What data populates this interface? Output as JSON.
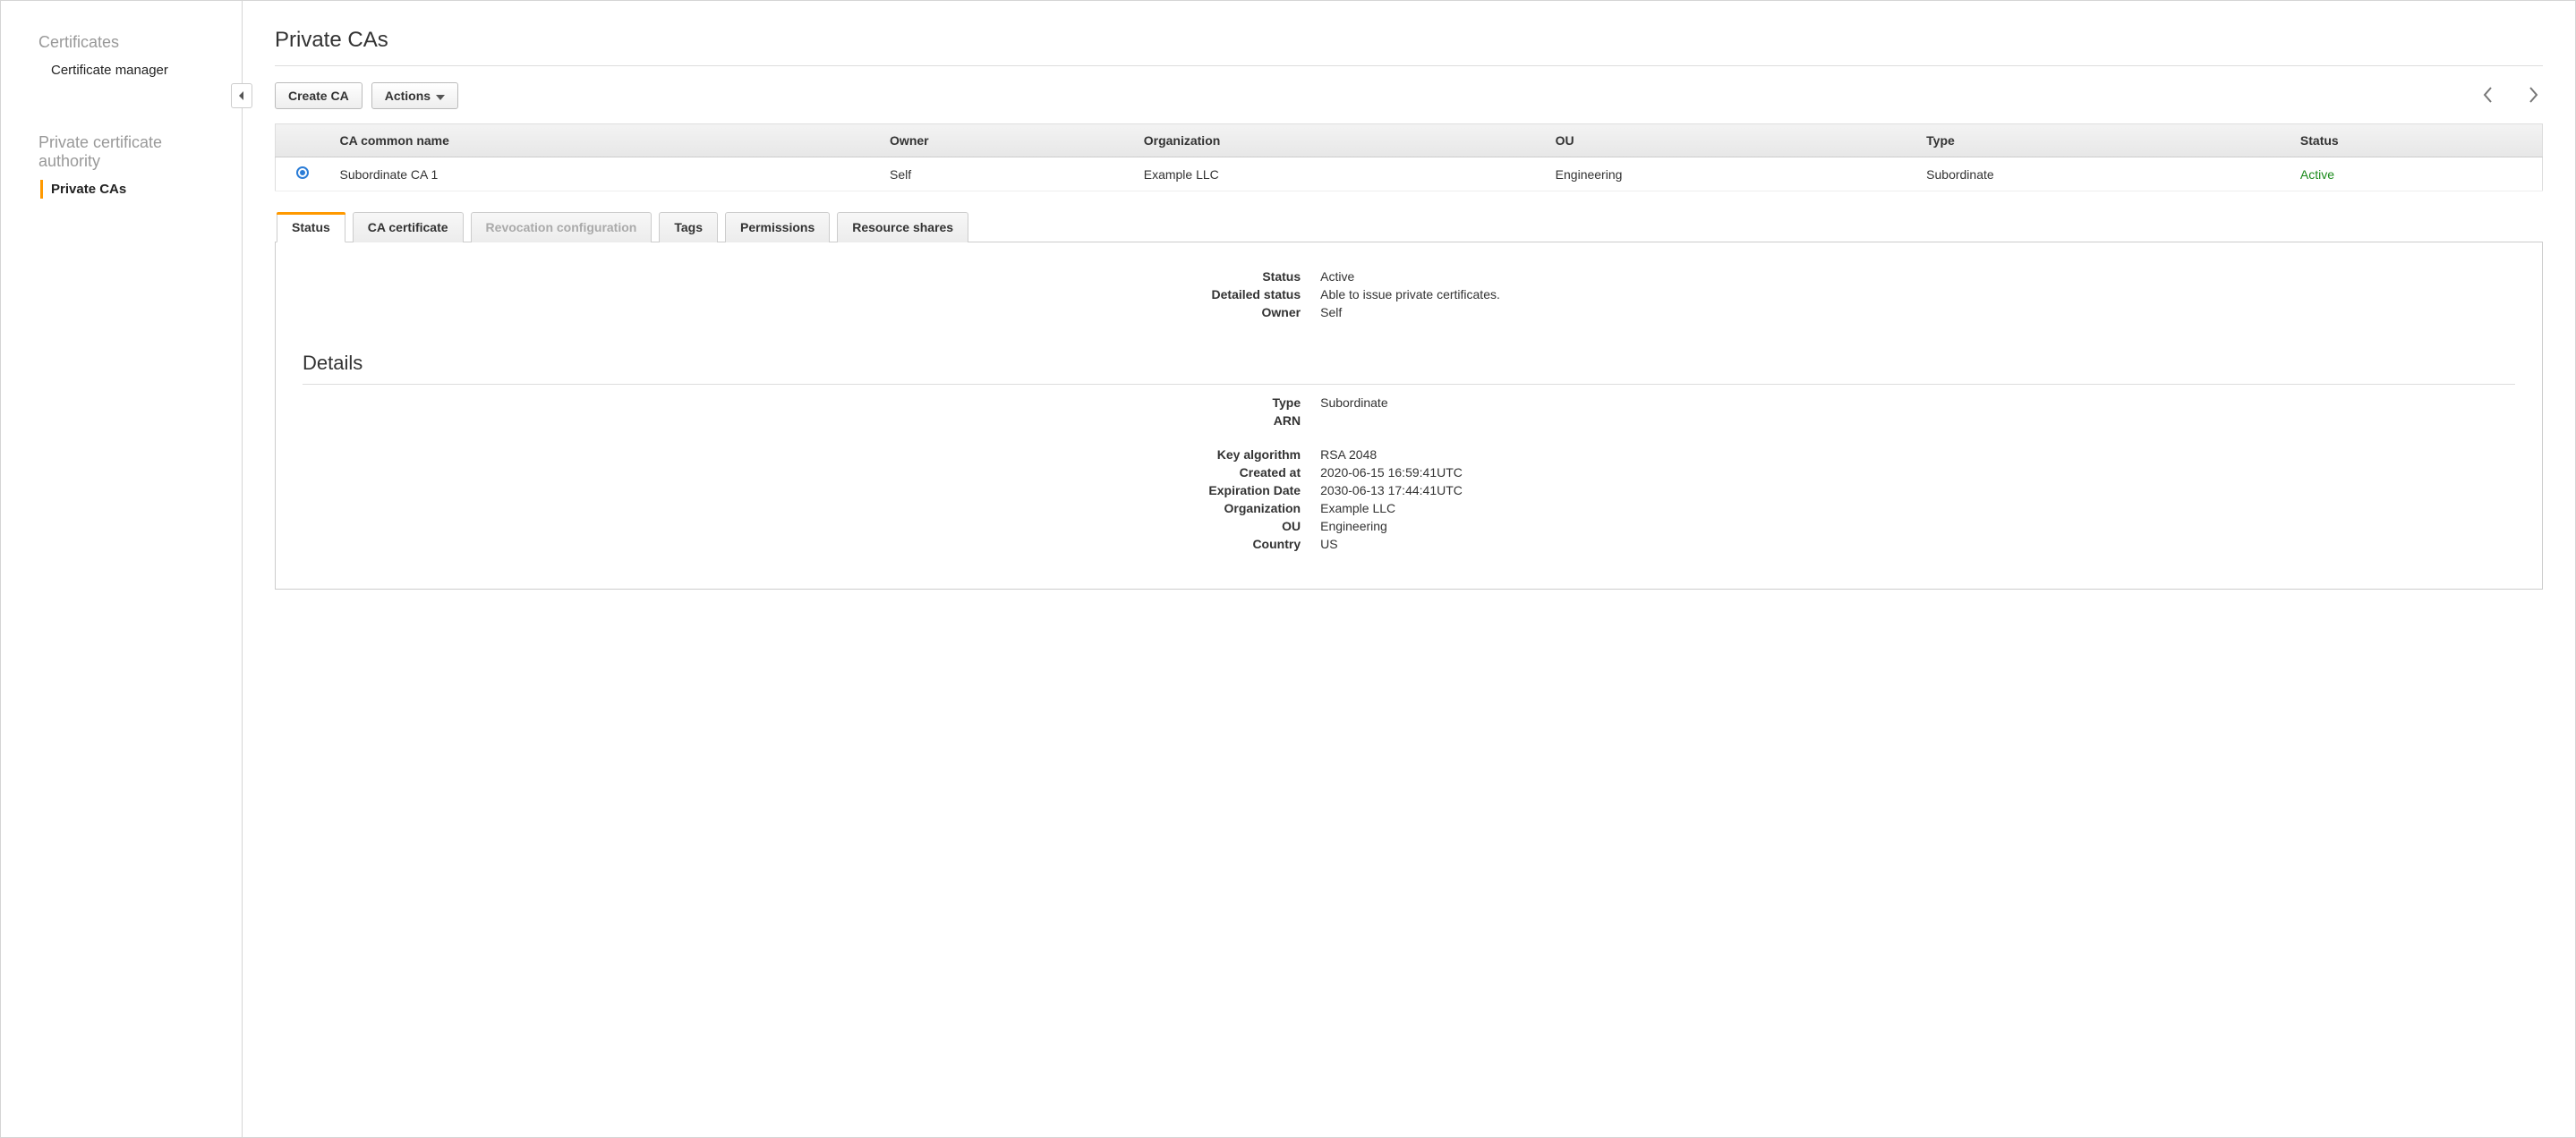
{
  "sidebar": {
    "groups": [
      {
        "title": "Certificates",
        "items": [
          {
            "label": "Certificate manager",
            "active": false
          }
        ]
      },
      {
        "title": "Private certificate authority",
        "items": [
          {
            "label": "Private CAs",
            "active": true
          }
        ]
      }
    ]
  },
  "page": {
    "title": "Private CAs"
  },
  "toolbar": {
    "create_label": "Create CA",
    "actions_label": "Actions"
  },
  "table": {
    "headers": {
      "name": "CA common name",
      "owner": "Owner",
      "org": "Organization",
      "ou": "OU",
      "type": "Type",
      "status": "Status"
    },
    "rows": [
      {
        "selected": true,
        "name": "Subordinate CA 1",
        "owner": "Self",
        "org": "Example LLC",
        "ou": "Engineering",
        "type": "Subordinate",
        "status": "Active"
      }
    ]
  },
  "tabs": [
    {
      "label": "Status",
      "active": true,
      "disabled": false
    },
    {
      "label": "CA certificate",
      "active": false,
      "disabled": false
    },
    {
      "label": "Revocation configuration",
      "active": false,
      "disabled": true
    },
    {
      "label": "Tags",
      "active": false,
      "disabled": false
    },
    {
      "label": "Permissions",
      "active": false,
      "disabled": false
    },
    {
      "label": "Resource shares",
      "active": false,
      "disabled": false
    }
  ],
  "status_block": {
    "labels": {
      "status": "Status",
      "detailed": "Detailed status",
      "owner": "Owner"
    },
    "values": {
      "status": "Active",
      "detailed": "Able to issue private certificates.",
      "owner": "Self"
    }
  },
  "details": {
    "heading": "Details",
    "labels": {
      "type": "Type",
      "arn": "ARN",
      "key_algo": "Key algorithm",
      "created": "Created at",
      "expires": "Expiration Date",
      "org": "Organization",
      "ou": "OU",
      "country": "Country"
    },
    "values": {
      "type": "Subordinate",
      "arn": "",
      "key_algo": "RSA 2048",
      "created": "2020-06-15 16:59:41UTC",
      "expires": "2030-06-13 17:44:41UTC",
      "org": "Example LLC",
      "ou": "Engineering",
      "country": "US"
    }
  }
}
